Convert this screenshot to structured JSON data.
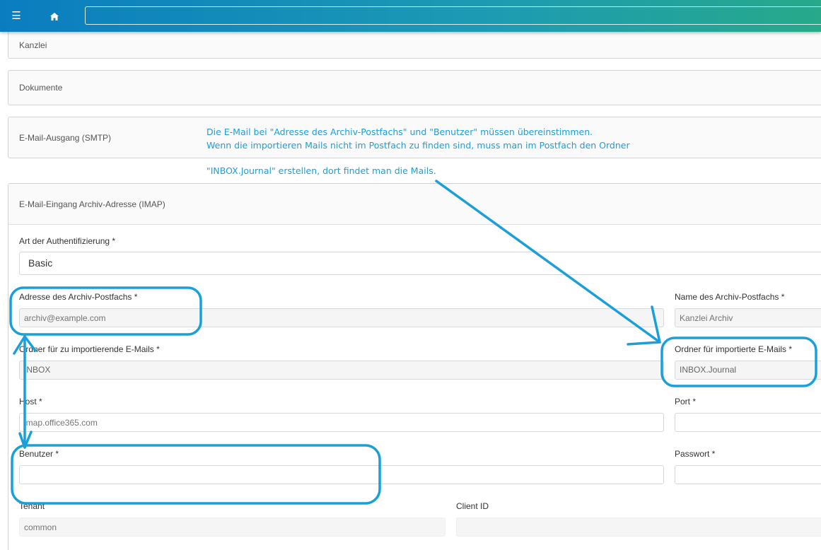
{
  "topbar": {
    "menu_icon": "menu-icon",
    "home_icon": "home-icon",
    "search_value": ""
  },
  "sections": {
    "kanzlei": "Kanzlei",
    "dokumente": "Dokumente",
    "smtp": "E-Mail-Ausgang (SMTP)",
    "imap": "E-Mail-Eingang Archiv-Adresse (IMAP)"
  },
  "annotation": {
    "line1": "Die E-Mail bei \"Adresse des Archiv-Postfachs\" und \"Benutzer\" müssen übereinstimmen.",
    "line2": "Wenn die importieren Mails nicht im Postfach zu finden sind, muss man im Postfach den Ordner",
    "line3": "\"INBOX.Journal\" erstellen, dort findet man die Mails.",
    "color": "#1a9fd8"
  },
  "form": {
    "auth_label": "Art der Authentifizierung  *",
    "auth_value": "Basic",
    "address_label": "Adresse des Archiv-Postfachs *",
    "address_placeholder": "archiv@example.com",
    "mailbox_name_label": "Name des Archiv-Postfachs  *",
    "mailbox_name_placeholder": "Kanzlei Archiv",
    "import_folder_label": "Ordner für zu importierende E-Mails  *",
    "import_folder_value": "INBOX",
    "imported_folder_label": "Ordner für importierte E-Mails  *",
    "imported_folder_value": "INBOX.Journal",
    "host_label": "Host *",
    "host_placeholder": "imap.office365.com",
    "port_label": "Port *",
    "user_label": "Benutzer *",
    "password_label": "Passwort *",
    "tenant_label": "Tenant",
    "tenant_placeholder": "common",
    "client_id_label": "Client ID"
  }
}
